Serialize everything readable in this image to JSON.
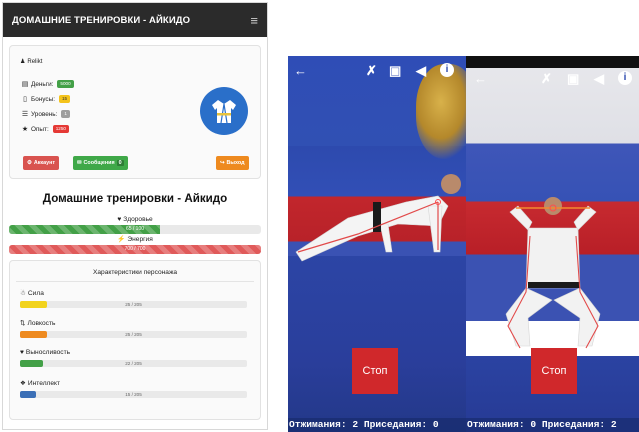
{
  "app": {
    "nav_title": "ДОМАШНИЕ ТРЕНИРОВКИ - АЙКИДО",
    "menu_icon": "hamburger-icon"
  },
  "profile": {
    "username": "Relikt",
    "stats": [
      {
        "icon": "money-icon",
        "label": "Деньги:",
        "value": "5000",
        "color": "#43a047"
      },
      {
        "icon": "bonus-icon",
        "label": "Бонусы:",
        "value": "15",
        "color": "#f4c31b"
      },
      {
        "icon": "level-icon",
        "label": "Уровень:",
        "value": "1",
        "color": "#9e9e9e"
      },
      {
        "icon": "star-icon",
        "label": "Опыт:",
        "value": "1250",
        "color": "#e53935"
      }
    ],
    "buttons": {
      "account": "Аккаунт",
      "messages": "Сообщения",
      "messages_count": "0",
      "logout": "Выход"
    }
  },
  "main": {
    "title": "Домашние тренировки - Айкидо",
    "health": {
      "label": "Здоровье",
      "text": "65 / 100",
      "fraction": 0.6
    },
    "energy": {
      "label": "Энергия",
      "text": "700 / 700",
      "fraction": 1.0
    }
  },
  "characteristics": {
    "title": "Характеристики персонажа",
    "items": [
      {
        "icon": "strength-icon",
        "label": "Сила",
        "value": "25 / 205",
        "fraction": 0.12,
        "color": "#f2d31c"
      },
      {
        "icon": "agility-icon",
        "label": "Ловкость",
        "value": "25 / 205",
        "fraction": 0.12,
        "color": "#ee8a1f"
      },
      {
        "icon": "heart-icon",
        "label": "Выносливость",
        "value": "22 / 205",
        "fraction": 0.1,
        "color": "#43a047"
      },
      {
        "icon": "brain-icon",
        "label": "Интеллект",
        "value": "15 / 205",
        "fraction": 0.07,
        "color": "#3b6fb6"
      }
    ]
  },
  "camera": {
    "stop_label": "Стоп",
    "counter_left": "Отжимания: 2 Приседания: 0",
    "counter_right": "Отжимания: 0 Приседания: 2"
  }
}
